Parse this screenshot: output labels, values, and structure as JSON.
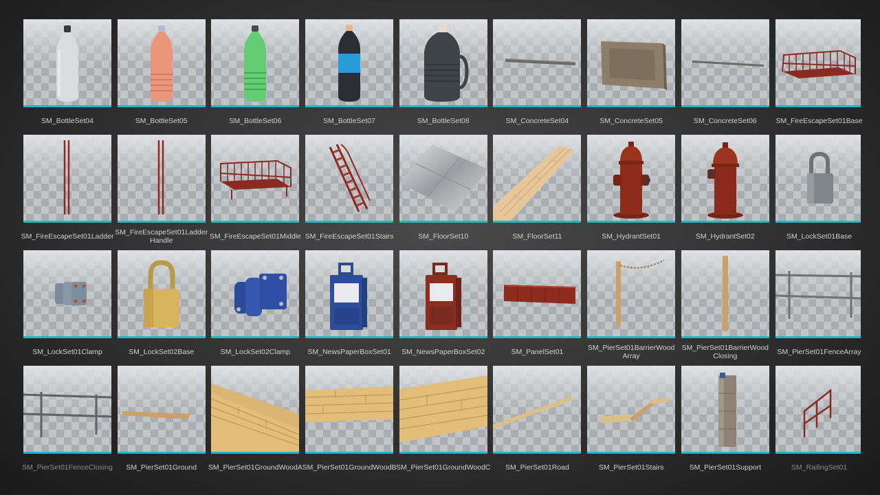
{
  "assets": [
    {
      "label": "SM_BottleSet04",
      "icon": "bottle-icon"
    },
    {
      "label": "SM_BottleSet05",
      "icon": "bottle-icon"
    },
    {
      "label": "SM_BottleSet06",
      "icon": "bottle-icon"
    },
    {
      "label": "SM_BottleSet07",
      "icon": "bottle-icon"
    },
    {
      "label": "SM_BottleSet08",
      "icon": "jug-icon"
    },
    {
      "label": "SM_ConcreteSet04",
      "icon": "concrete-bar-icon"
    },
    {
      "label": "SM_ConcreteSet05",
      "icon": "concrete-panel-icon"
    },
    {
      "label": "SM_ConcreteSet06",
      "icon": "concrete-bar-icon"
    },
    {
      "label": "SM_FireEscapeSet01Base",
      "icon": "fire-escape-base-icon"
    },
    {
      "label": "SM_FireEscapeSet01Ladder",
      "icon": "ladder-rails-icon"
    },
    {
      "label": "SM_FireEscapeSet01Ladder Handle",
      "icon": "ladder-handle-icon"
    },
    {
      "label": "SM_FireEscapeSet01Middle",
      "icon": "fire-escape-middle-icon"
    },
    {
      "label": "SM_FireEscapeSet01Stairs",
      "icon": "stairs-icon"
    },
    {
      "label": "SM_FloorSet10",
      "icon": "metal-floor-icon"
    },
    {
      "label": "SM_FloorSet11",
      "icon": "wood-floor-icon"
    },
    {
      "label": "SM_HydrantSet01",
      "icon": "hydrant-icon"
    },
    {
      "label": "SM_HydrantSet02",
      "icon": "hydrant-icon"
    },
    {
      "label": "SM_LockSet01Base",
      "icon": "padlock-icon"
    },
    {
      "label": "SM_LockSet01Clamp",
      "icon": "clamp-icon"
    },
    {
      "label": "SM_LockSet02Base",
      "icon": "padlock-icon"
    },
    {
      "label": "SM_LockSet02Clamp",
      "icon": "clamp-icon"
    },
    {
      "label": "SM_NewsPaperBoxSet01",
      "icon": "newspaper-box-icon"
    },
    {
      "label": "SM_NewsPaperBoxSet02",
      "icon": "newspaper-box-icon"
    },
    {
      "label": "SM_PanelSet01",
      "icon": "panel-icon"
    },
    {
      "label": "SM_PierSet01BarrierWood Array",
      "icon": "wood-post-chain-icon"
    },
    {
      "label": "SM_PierSet01BarrierWood Closing",
      "icon": "wood-post-icon"
    },
    {
      "label": "SM_PierSet01FenceArray",
      "icon": "fence-icon"
    },
    {
      "label": "SM_PierSet01FenceClosing",
      "icon": "fence-icon"
    },
    {
      "label": "SM_PierSet01Ground",
      "icon": "plank-icon"
    },
    {
      "label": "SM_PierSet01GroundWoodA",
      "icon": "wood-deck-icon"
    },
    {
      "label": "SM_PierSet01GroundWoodB",
      "icon": "wood-deck-icon"
    },
    {
      "label": "SM_PierSet01GroundWoodC",
      "icon": "wood-deck-icon"
    },
    {
      "label": "SM_PierSet01Road",
      "icon": "plank-icon"
    },
    {
      "label": "SM_PierSet01Stairs",
      "icon": "pier-stairs-icon"
    },
    {
      "label": "SM_PierSet01Support",
      "icon": "support-pillar-icon"
    },
    {
      "label": "SM_RailingSet01",
      "icon": "railing-icon"
    }
  ],
  "colors": {
    "accent": "#1fb8c6",
    "label": "#d0d0d0"
  }
}
